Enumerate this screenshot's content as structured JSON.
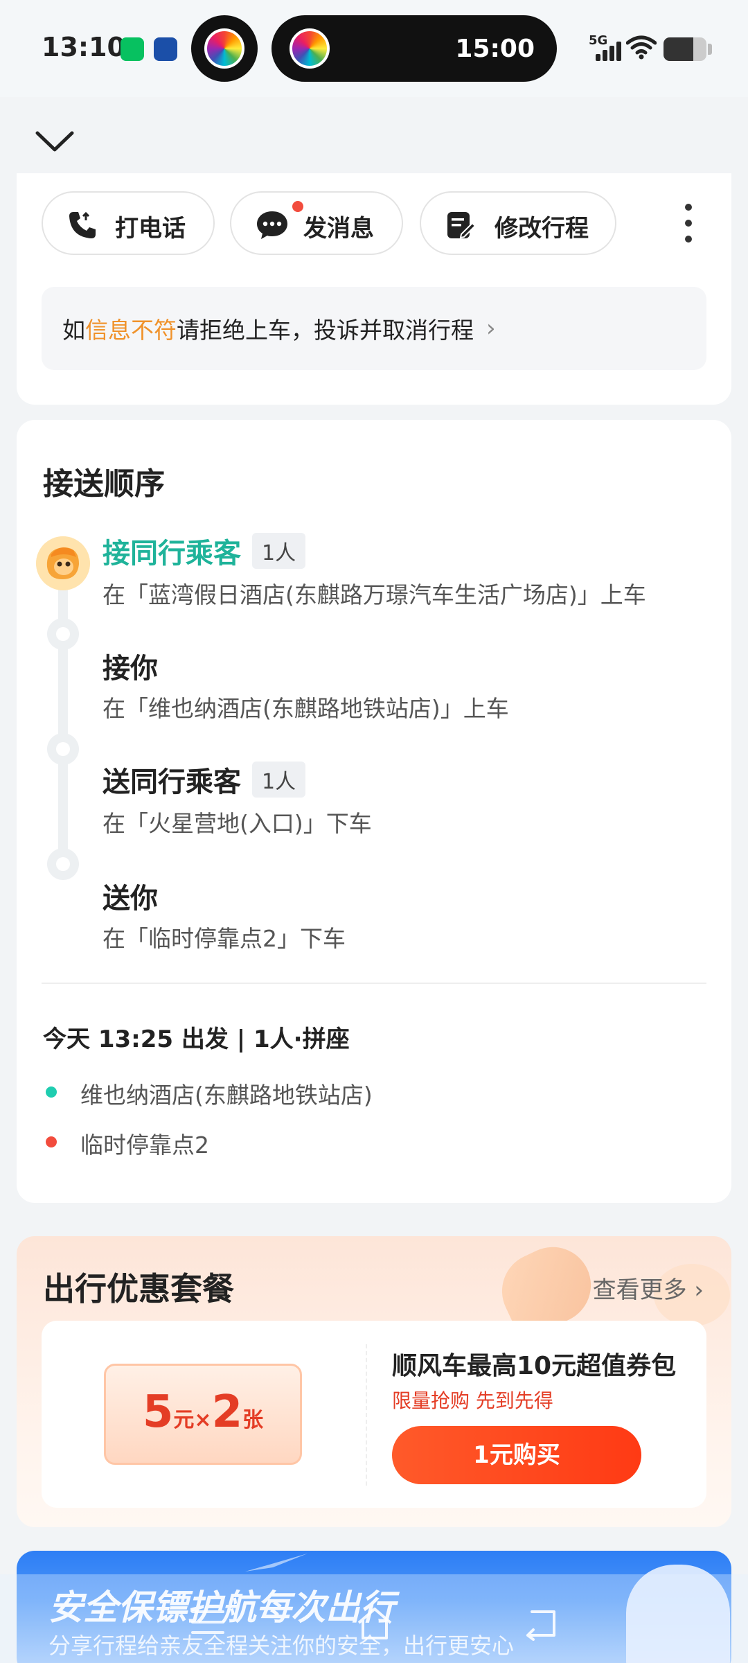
{
  "status_bar": {
    "time": "13:10",
    "live_activity_time": "15:00",
    "network": "5G"
  },
  "actions": {
    "call": "打电话",
    "message": "发消息",
    "edit_trip": "修改行程"
  },
  "notice": {
    "prefix": "如",
    "highlight": "信息不符",
    "suffix": "请拒绝上车，投诉并取消行程",
    "highlight_color": "#f0922a"
  },
  "pickup_order": {
    "title": "接送顺序",
    "stops": [
      {
        "title": "接同行乘客",
        "badge": "1人",
        "desc": "在「蓝湾假日酒店(东麒路万璟汽车生活广场店)」上车"
      },
      {
        "title": "接你",
        "badge": "",
        "desc": "在「维也纳酒店(东麒路地铁站店)」上车"
      },
      {
        "title": "送同行乘客",
        "badge": "1人",
        "desc": "在「火星营地(入口)」下车"
      },
      {
        "title": "送你",
        "badge": "",
        "desc": "在「临时停靠点2」下车"
      }
    ]
  },
  "trip": {
    "summary": "今天 13:25 出发 | 1人·拼座",
    "origin": "维也纳酒店(东麒路地铁站店)",
    "destination": "临时停靠点2",
    "origin_color": "#1fcdb0",
    "destination_color": "#f24c3d"
  },
  "promo": {
    "title": "出行优惠套餐",
    "see_more": "查看更多",
    "coupon_amount": "5",
    "coupon_unit": "元",
    "coupon_times": "×",
    "coupon_count": "2",
    "coupon_count_unit": "张",
    "name": "顺风车最高10元超值券包",
    "subtitle": "限量抢购 先到先得",
    "buy_label": "1元购买"
  },
  "safety_banner": {
    "title": "安全保镖护航每次出行",
    "subtitle": "分享行程给亲友全程关注你的安全，出行更安心"
  },
  "colors": {
    "accent_green": "#1fb39a",
    "promo_red": "#e43d25",
    "buy_button": "#ff4a1f",
    "banner_blue": "#2e7ef5"
  }
}
